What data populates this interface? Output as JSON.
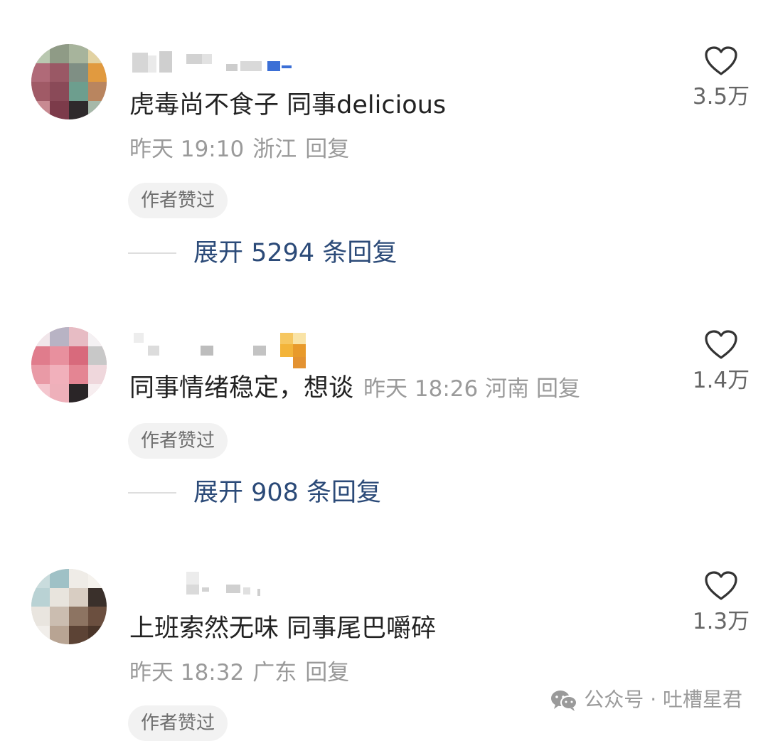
{
  "comments": [
    {
      "text": "虎毒尚不食子 同事delicious",
      "time": "昨天 19:10",
      "location": "浙江",
      "reply_label": "回复",
      "badge": "作者赞过",
      "expand_label": "展开 5294 条回复",
      "likes": "3.5万",
      "heart_icon": "heart-outline-icon"
    },
    {
      "text": "同事情绪稳定，想谈",
      "time": "昨天 18:26",
      "location": "河南",
      "reply_label": "回复",
      "badge": "作者赞过",
      "expand_label": "展开 908 条回复",
      "likes": "1.4万",
      "heart_icon": "heart-outline-icon"
    },
    {
      "text": "上班索然无味 同事尾巴嚼碎",
      "time": "昨天 18:32",
      "location": "广东",
      "reply_label": "回复",
      "badge": "作者赞过",
      "likes": "1.3万",
      "heart_icon": "heart-outline-icon"
    }
  ],
  "watermark": {
    "text": "公众号 · 吐槽星君",
    "icon": "wechat-icon"
  },
  "colors": {
    "text": "#222222",
    "meta": "#9a9a9a",
    "expand_link": "#2b4a78",
    "badge_bg": "#f2f2f2"
  }
}
